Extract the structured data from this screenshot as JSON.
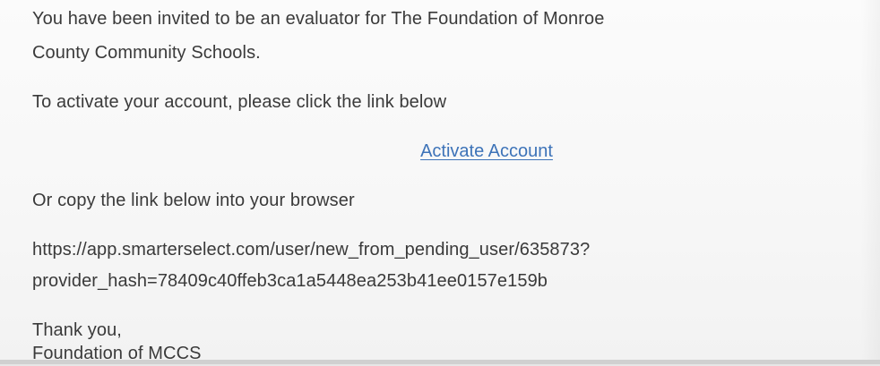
{
  "email": {
    "intro_line_1": "You have been invited to be an evaluator for The Foundation of Monroe",
    "intro_line_2": "County Community Schools.",
    "activate_prompt": "To activate your account, please click the link below",
    "activate_link_label": "Activate Account",
    "copy_prompt": "Or copy the link below into your browser",
    "url_line_1": "https://app.smarterselect.com/user/new_from_pending_user/635873?",
    "url_line_2": "provider_hash=78409c40ffeb3ca1a5448ea253b41ee0157e159b",
    "signoff": "Thank you,",
    "signature": "Foundation of MCCS"
  },
  "colors": {
    "text": "#3a3a3a",
    "link": "#3d73b8",
    "background": "#f7f7f7"
  }
}
